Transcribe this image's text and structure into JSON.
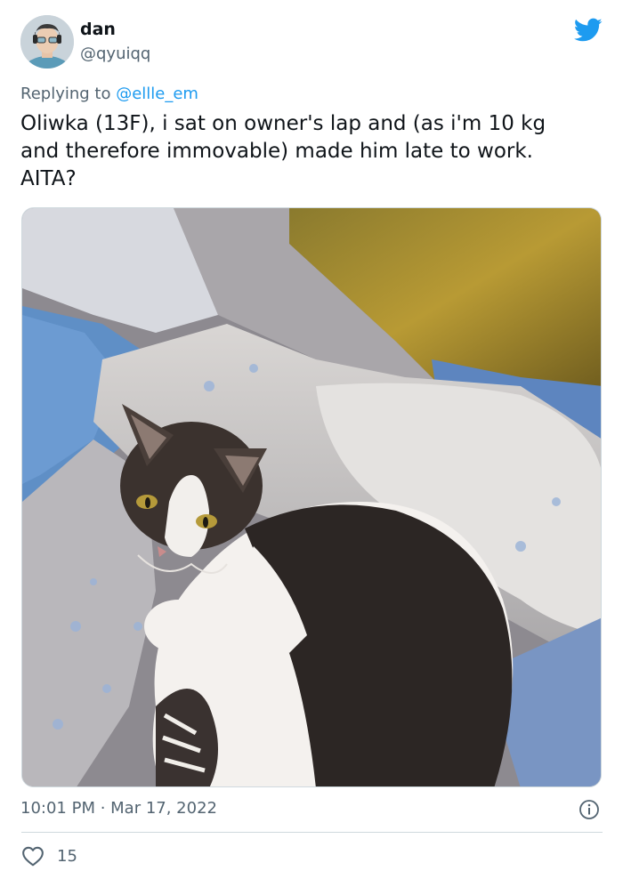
{
  "user": {
    "display_name": "dan",
    "handle": "@qyuiqq"
  },
  "reply": {
    "prefix": "Replying to ",
    "to_handle": "@ellle_em"
  },
  "tweet": {
    "text": "Oliwka (13F), i sat on owner's lap and (as i'm 10 kg\nand therefore immovable) made him late to work.\nAITA?",
    "time": "10:01 PM",
    "separator": " · ",
    "date": "Mar 17, 2022"
  },
  "engagement": {
    "likes": "15"
  },
  "icons": {
    "logo": "twitter-bird-icon",
    "info": "info-icon",
    "like": "heart-outline-icon"
  },
  "colors": {
    "brand": "#1d9bf0",
    "text_primary": "#0f1419",
    "text_secondary": "#536471",
    "border": "#cfd9de"
  }
}
